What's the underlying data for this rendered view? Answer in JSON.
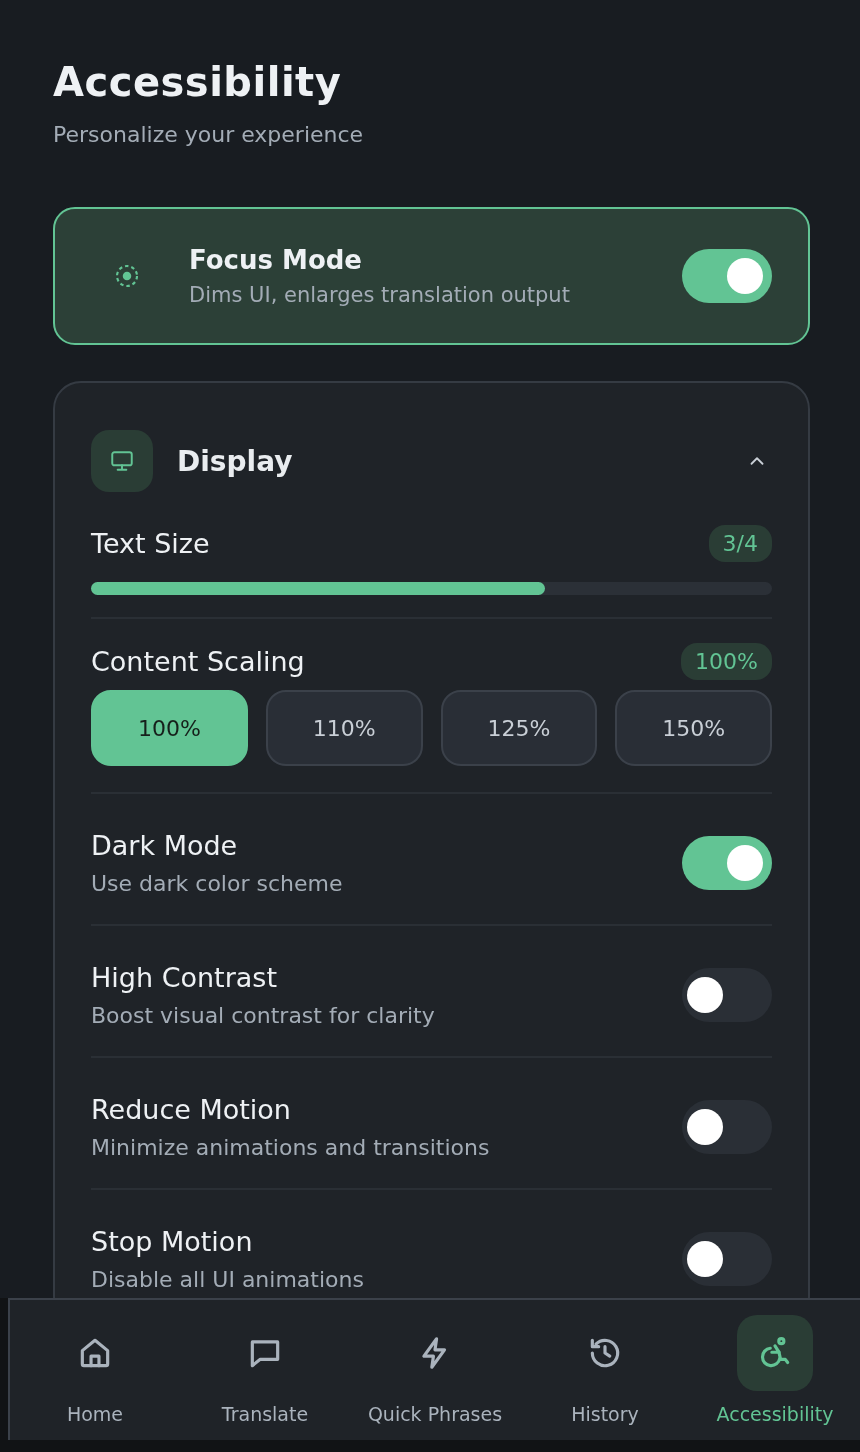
{
  "header": {
    "title": "Accessibility",
    "subtitle": "Personalize your experience"
  },
  "focus_mode": {
    "title": "Focus Mode",
    "description": "Dims UI, enlarges translation output",
    "on": true
  },
  "display": {
    "title": "Display",
    "expanded": true,
    "text_size": {
      "label": "Text Size",
      "badge": "3/4",
      "level": 0.667
    },
    "content_scaling": {
      "label": "Content Scaling",
      "badge": "100%",
      "options": [
        {
          "label": "100%",
          "selected": true
        },
        {
          "label": "110%",
          "selected": false
        },
        {
          "label": "125%",
          "selected": false
        },
        {
          "label": "150%",
          "selected": false
        }
      ]
    },
    "toggles": [
      {
        "title": "Dark Mode",
        "description": "Use dark color scheme",
        "on": true
      },
      {
        "title": "High Contrast",
        "description": "Boost visual contrast for clarity",
        "on": false
      },
      {
        "title": "Reduce Motion",
        "description": "Minimize animations and transitions",
        "on": false
      },
      {
        "title": "Stop Motion",
        "description": "Disable all UI animations",
        "on": false
      }
    ]
  },
  "nav": [
    {
      "label": "Home",
      "selected": false
    },
    {
      "label": "Translate",
      "selected": false
    },
    {
      "label": "Quick Phrases",
      "selected": false
    },
    {
      "label": "History",
      "selected": false
    },
    {
      "label": "Accessibility",
      "selected": true
    }
  ]
}
